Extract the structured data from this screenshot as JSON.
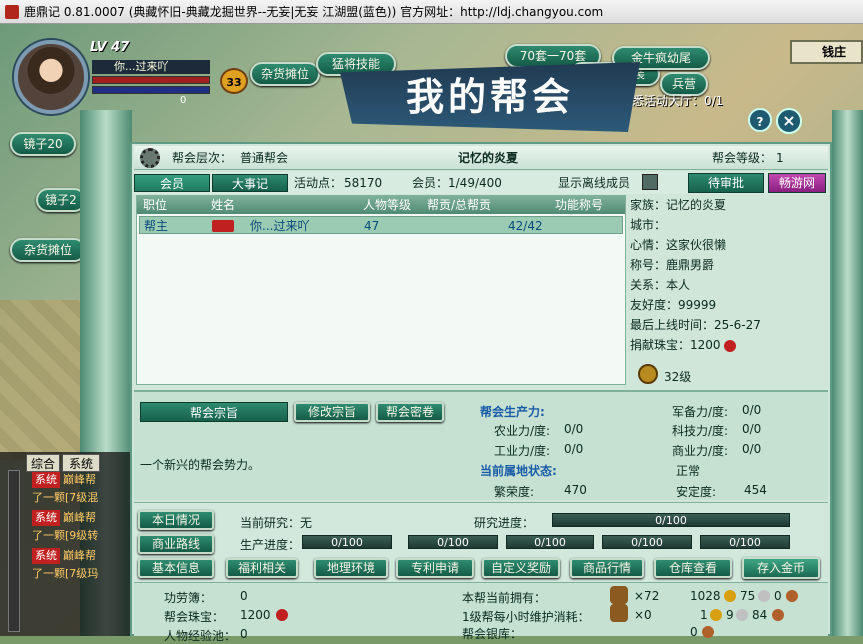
{
  "window_title": "鹿鼎记 0.81.0007 (典藏怀旧-典藏龙掘世界--无妄|无妄 江湖盟(蓝色))    官方网址：http://ldj.changyou.com",
  "player": {
    "level": "LV 47",
    "name": "你...过来吖",
    "hp_value": "0",
    "badge": "33"
  },
  "hud_buttons": {
    "mirror20": "镜子20",
    "mirror2": "镜子2",
    "stall": "杂货摊位",
    "stall_top": "杂货摊位",
    "skill": "猛将技能",
    "set70": "70套一70套",
    "set_combo": "聚睡一伪装",
    "soldier": "兵营",
    "top_right": "钱庄",
    "corner": "金牛疯幼尾"
  },
  "task_text": "熟悉活动大厅：0/1",
  "banner_title": "我的帮会",
  "controls": {
    "help": "?",
    "close": "×"
  },
  "header": {
    "level_label": "帮会层次：",
    "level_value": "普通帮会",
    "guild_name": "记忆的炎夏",
    "rank_label": "帮会等级：",
    "rank_value": "1"
  },
  "tabs": [
    {
      "label": "会员"
    },
    {
      "label": "大事记"
    }
  ],
  "stats": {
    "active_label": "活动点：",
    "active_value": "58170",
    "member_label": "会员：",
    "member_value": "1/49/400",
    "show_offline": "显示离线成员"
  },
  "actions": {
    "pending": "待审批",
    "changyou": "畅游网"
  },
  "member_table": {
    "columns": [
      "职位",
      "姓名",
      "人物等级",
      "帮贡/总帮贡",
      "功能称号"
    ],
    "rows": [
      {
        "post": "帮主",
        "name": "你...过来吖",
        "level": "47",
        "contribution": "42/42",
        "title": ""
      }
    ]
  },
  "detail": {
    "family": "家族：记忆的炎夏",
    "city": "城市：",
    "mood": "心情：这家伙很懒",
    "title": "称号：鹿鼎男爵",
    "relation": "关系：本人",
    "friendship": "友好度：99999",
    "last_online": "最后上线时间：25-6-27",
    "donate": "捐献珠宝：1200",
    "level": "32级"
  },
  "motto": {
    "header": "帮会宗旨",
    "edit": "修改宗旨",
    "secret": "帮会密卷",
    "text": "一个新兴的帮会势力。"
  },
  "production": {
    "title": "帮会生产力:",
    "farm_label": "农业力/度:",
    "farm_value": "0/0",
    "industry_label": "工业力/度:",
    "industry_value": "0/0",
    "army_label": "军备力/度:",
    "army_value": "0/0",
    "tech_label": "科技力/度:",
    "tech_value": "0/0",
    "commerce_label": "商业力/度:",
    "commerce_value": "0/0",
    "state_title": "当前属地状态:",
    "prosperity_label": "繁荣度:",
    "prosperity_value": "470",
    "normal": "正常",
    "stability_label": "安定度:",
    "stability_value": "454"
  },
  "research": {
    "today": "本日情况",
    "route": "商业路线",
    "current_label": "当前研究：无",
    "progress_label": "研究进度：",
    "progress_value": "0/100",
    "prod_label": "生产进度：",
    "bars": [
      "0/100",
      "0/100",
      "0/100",
      "0/100",
      "0/100"
    ]
  },
  "nav_buttons": [
    "基本信息",
    "福利相关",
    "地理环境",
    "专利申请",
    "自定义奖励",
    "商品行情",
    "仓库查看",
    "存入金币"
  ],
  "bottom": {
    "merit_label": "功劳簿：",
    "merit_value": "0",
    "jewel_label": "帮会珠宝：",
    "jewel_value": "1200",
    "exp_label": "人物经验池：",
    "exp_value": "0",
    "own_label": "本帮当前拥有：",
    "own_x": "×72",
    "own_money": "1028",
    "own_silver": "75",
    "own_copper": "0",
    "upkeep_label": "1级帮每小时维护消耗：",
    "upkeep_x": "×0",
    "upkeep_money": "1",
    "upkeep_silver": "9",
    "upkeep_copper": "84",
    "bank_label": "帮会银库：",
    "bank_value": "0"
  },
  "chat": {
    "tabs": [
      "综合",
      "系统"
    ],
    "lines": [
      {
        "badge": "系统",
        "text": "巅峰帮"
      },
      {
        "badge": "",
        "text": "了一颗[7级混"
      },
      {
        "badge": "系统",
        "text": "巅峰帮"
      },
      {
        "badge": "",
        "text": "了一颗[9级转"
      },
      {
        "badge": "系统",
        "text": "巅峰帮"
      },
      {
        "badge": "",
        "text": "了一颗[7级玛"
      }
    ]
  }
}
